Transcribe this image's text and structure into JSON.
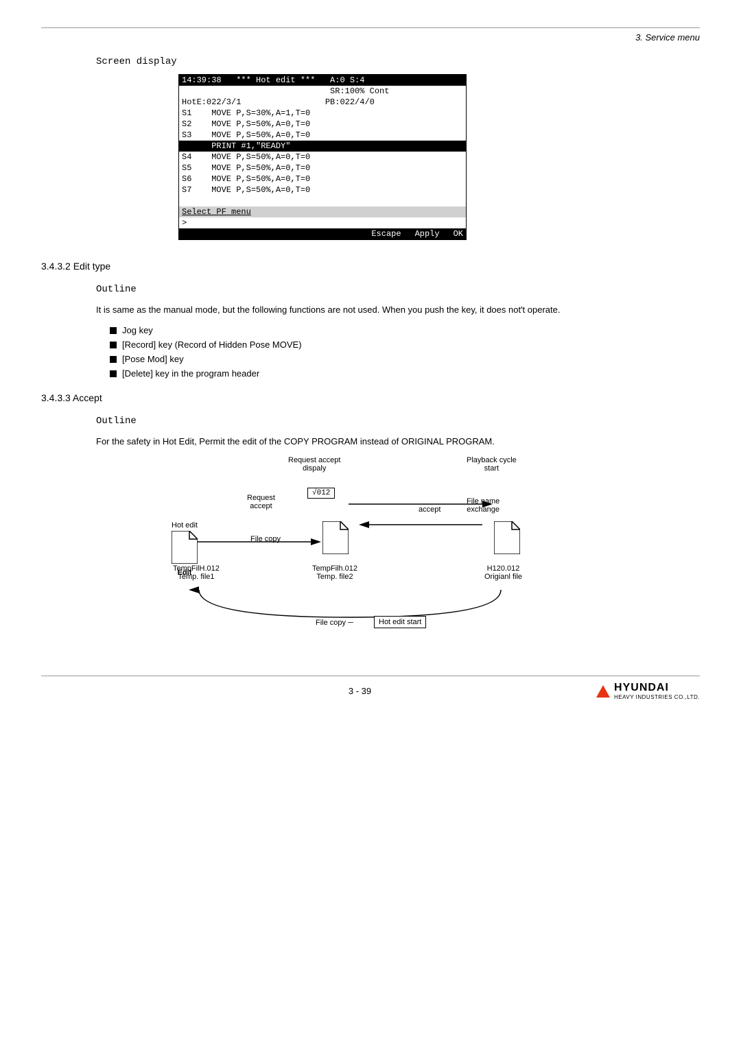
{
  "header": {
    "rule": true,
    "section": "3. Service menu"
  },
  "screen_display": {
    "label": "Screen display",
    "rows": [
      {
        "text": "14:39:38   *** Hot edit ***   A:0 S:4",
        "style": "inverted"
      },
      {
        "text": "                              SR:100% Cont",
        "style": "normal"
      },
      {
        "text": "HotE:022/3/1                 PB:022/4/0",
        "style": "normal"
      },
      {
        "text": "S1    MOVE P,S=30%,A=1,T=0",
        "style": "normal"
      },
      {
        "text": "S2    MOVE P,S=50%,A=0,T=0",
        "style": "normal"
      },
      {
        "text": "S3    MOVE P,S=50%,A=0,T=0",
        "style": "normal"
      },
      {
        "text": "      PRINT #1,\"READY\"",
        "style": "highlight"
      },
      {
        "text": "S4    MOVE P,S=50%,A=0,T=0",
        "style": "normal"
      },
      {
        "text": "S5    MOVE P,S=50%,A=0,T=0",
        "style": "normal"
      },
      {
        "text": "S6    MOVE P,S=50%,A=0,T=0",
        "style": "normal"
      },
      {
        "text": "S7    MOVE P,S=50%,A=0,T=0",
        "style": "normal"
      },
      {
        "text": "",
        "style": "normal"
      },
      {
        "text": "Select PF menu",
        "style": "select"
      },
      {
        "text": ">",
        "style": "normal"
      }
    ],
    "bottom_bar": [
      "Escape",
      "Apply",
      "OK"
    ]
  },
  "section_342": {
    "title": "3.4.3.2 Edit type",
    "outline_label": "Outline",
    "body_text": "It is same as the manual mode, but the following functions are not used. When you push the key, it does not't operate.",
    "bullets": [
      "Jog key",
      "[Record] key (Record of Hidden Pose MOVE)",
      "[Pose Mod] key",
      "[Delete] key in the program header"
    ]
  },
  "section_343": {
    "title": "3.4.3.3 Accept",
    "outline_label": "Outline",
    "body_text": "For the safety in Hot Edit, Permit the edit of the COPY PROGRAM instead of ORIGINAL PROGRAM.",
    "diagram": {
      "labels": {
        "request_accept_display": "Request accept\ndispaly",
        "playback_cycle_start": "Playback cycle\nstart",
        "request_accept": "Request\naccept",
        "hot_edit": "Hot edit",
        "file_copy1": "File copy",
        "accept": "accept",
        "file_name_exchange": "File name\nexchange",
        "file_copy2": "File copy",
        "hot_edit_start": "Hot edit start",
        "edit": "Edit",
        "v012": "√012",
        "temp1_name": "TempFilH.012",
        "temp1_sub": "Temp. file1",
        "temp2_name": "TempFilh.012",
        "temp2_sub": "Temp. file2",
        "original_name": "H120.012",
        "original_sub": "Origianl file"
      }
    }
  },
  "footer": {
    "page_number": "3 - 39",
    "logo_name": "HYUNDAI",
    "logo_sub": "HEAVY INDUSTRIES CO.,LTD."
  }
}
